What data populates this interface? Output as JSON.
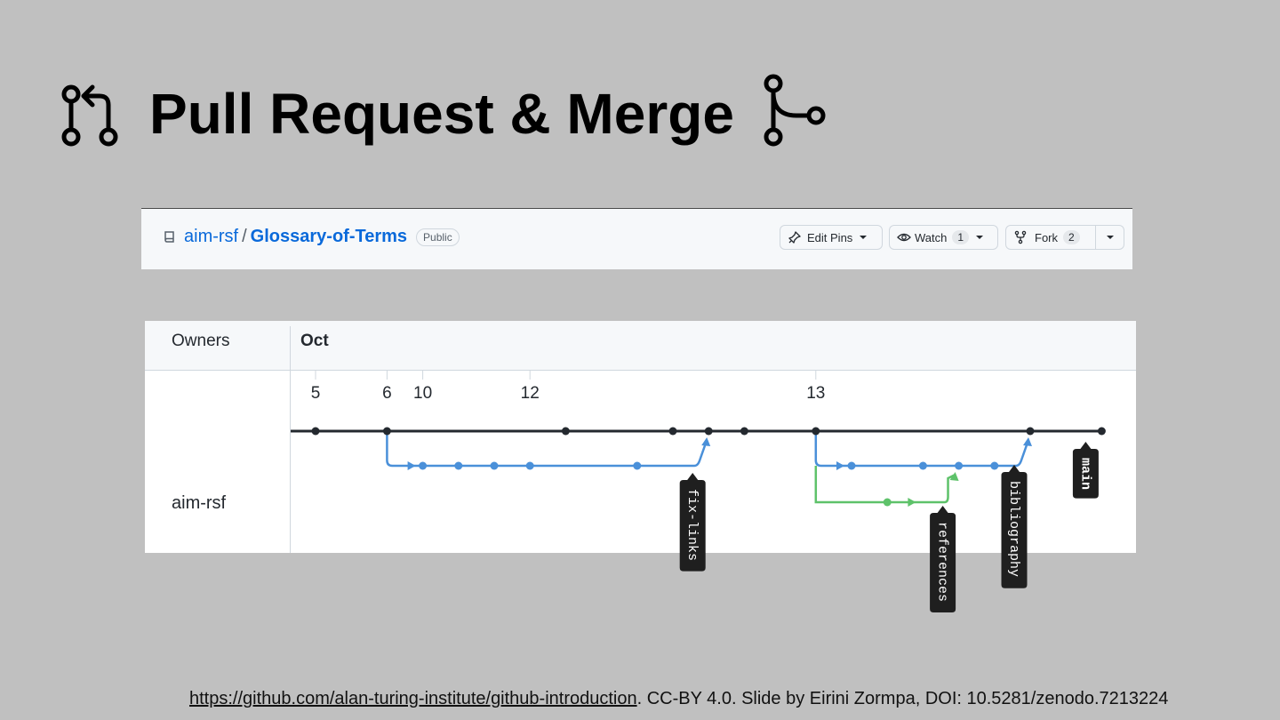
{
  "slide": {
    "title": "Pull Request & Merge",
    "footer_link": "https://github.com/alan-turing-institute/github-introduction",
    "footer_text": ". CC-BY 4.0. Slide by Eirini Zormpa, DOI: 10.5281/zenodo.7213224"
  },
  "repo": {
    "owner": "aim-rsf",
    "separator": "/",
    "name": "Glossary-of-Terms",
    "visibility": "Public",
    "buttons": {
      "edit_pins": "Edit Pins",
      "watch": "Watch",
      "watch_count": "1",
      "fork": "Fork",
      "fork_count": "2"
    }
  },
  "network": {
    "owners_header": "Owners",
    "month": "Oct",
    "owner": "aim-rsf",
    "colors": {
      "main": "#24292f",
      "blue": "#4a90d9",
      "green": "#5ec26a"
    },
    "dates": [
      {
        "label": "5",
        "col": 0
      },
      {
        "label": "6",
        "col": 2
      },
      {
        "label": "10",
        "col": 3
      },
      {
        "label": "12",
        "col": 6
      },
      {
        "label": "13",
        "col": 14
      }
    ],
    "branch_labels": [
      {
        "name": "fix-links",
        "col": 11,
        "row": 1
      },
      {
        "name": "references",
        "col": 18,
        "row": 2
      },
      {
        "name": "bibliography",
        "col": 20,
        "row": 1
      },
      {
        "name": "main",
        "col": 22,
        "row": 0
      }
    ]
  }
}
